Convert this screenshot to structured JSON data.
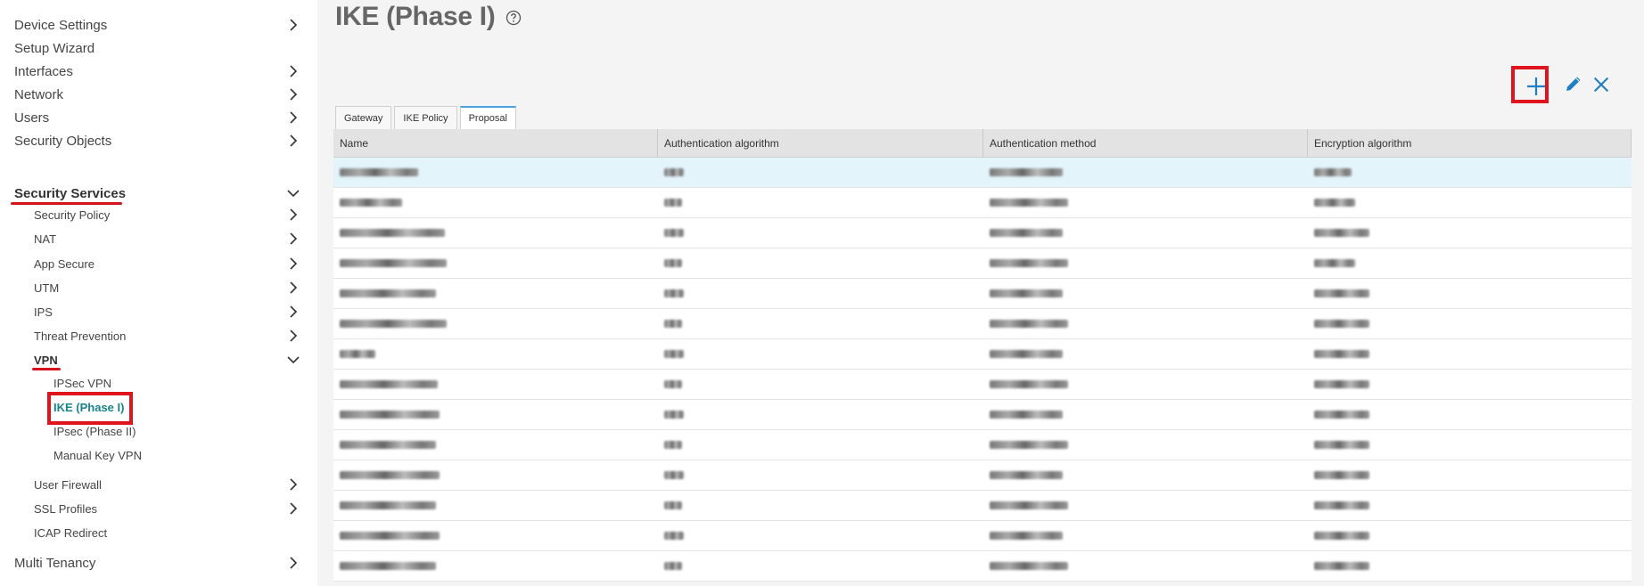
{
  "page": {
    "title": "IKE (Phase I)"
  },
  "colors": {
    "accent": "#1f7fc2",
    "highlight_red": "#e0141c",
    "active_teal": "#17838a",
    "selected_row": "#e3f4fb"
  },
  "sidebar": {
    "items": [
      {
        "label": "Device Settings",
        "icon": "chevron-right-icon"
      },
      {
        "label": "Setup Wizard"
      },
      {
        "label": "Interfaces",
        "icon": "chevron-right-icon"
      },
      {
        "label": "Network",
        "icon": "chevron-right-icon"
      },
      {
        "label": "Users",
        "icon": "chevron-right-icon"
      },
      {
        "label": "Security Objects",
        "icon": "chevron-right-icon"
      },
      {
        "label": "Security Services",
        "icon": "chevron-down-icon",
        "expanded": true
      },
      {
        "label": "Security Policy",
        "icon": "chevron-right-icon"
      },
      {
        "label": "NAT",
        "icon": "chevron-right-icon"
      },
      {
        "label": "App Secure",
        "icon": "chevron-right-icon"
      },
      {
        "label": "UTM",
        "icon": "chevron-right-icon"
      },
      {
        "label": "IPS",
        "icon": "chevron-right-icon"
      },
      {
        "label": "Threat Prevention",
        "icon": "chevron-right-icon"
      },
      {
        "label": "VPN",
        "icon": "chevron-down-icon",
        "expanded": true
      },
      {
        "label": "IPSec VPN"
      },
      {
        "label": "IKE (Phase I)",
        "active": true
      },
      {
        "label": "IPsec (Phase II)"
      },
      {
        "label": "Manual Key VPN"
      },
      {
        "label": "User Firewall",
        "icon": "chevron-right-icon"
      },
      {
        "label": "SSL Profiles",
        "icon": "chevron-right-icon"
      },
      {
        "label": "ICAP Redirect"
      },
      {
        "label": "Multi Tenancy",
        "icon": "chevron-right-icon"
      }
    ]
  },
  "toolbar": {
    "add_icon": "plus-icon",
    "edit_icon": "pencil-icon",
    "delete_icon": "close-icon"
  },
  "tabs": [
    {
      "label": "Gateway"
    },
    {
      "label": "IKE Policy"
    },
    {
      "label": "Proposal",
      "active": true
    }
  ],
  "table": {
    "columns": [
      "Name",
      "Authentication algorithm",
      "Authentication method",
      "Encryption algorithm"
    ],
    "row_count": 14,
    "selected_row": 0
  }
}
